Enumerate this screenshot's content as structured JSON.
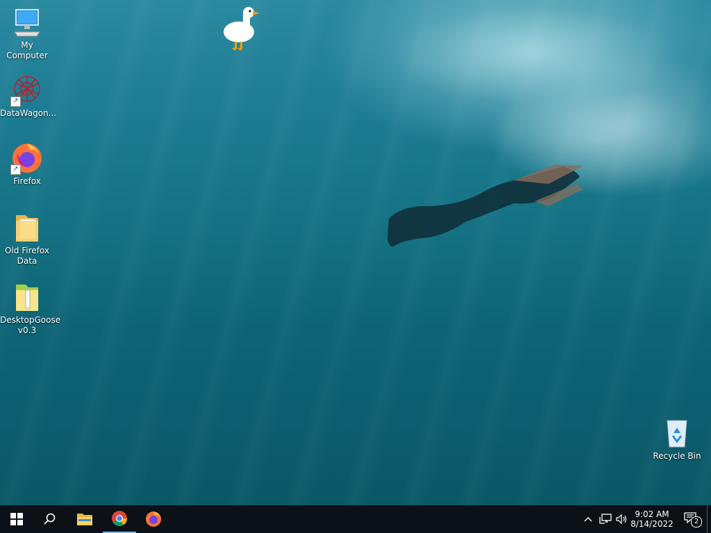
{
  "desktop": {
    "icons": [
      {
        "label": "My Computer",
        "icon": "computer-icon"
      },
      {
        "label": "DataWagon...",
        "icon": "datawagon-icon",
        "shortcut": true
      },
      {
        "label": "Firefox",
        "icon": "firefox-icon",
        "shortcut": true
      },
      {
        "label": "Old Firefox Data",
        "icon": "folder-icon"
      },
      {
        "label": "DesktopGoose v0.3",
        "icon": "zip-folder-icon"
      },
      {
        "label": "Recycle Bin",
        "icon": "recycle-bin-icon"
      }
    ]
  },
  "taskbar": {
    "start": "windows-logo-icon",
    "search": "search-icon",
    "pinned": [
      "file-explorer-icon",
      "chrome-icon",
      "firefox-icon"
    ],
    "tray": {
      "time": "9:02 AM",
      "date": "8/14/2022",
      "notifications_count": "2"
    }
  },
  "colors": {
    "taskbar_bg": "#0b1116",
    "accent": "#76b9ed"
  }
}
